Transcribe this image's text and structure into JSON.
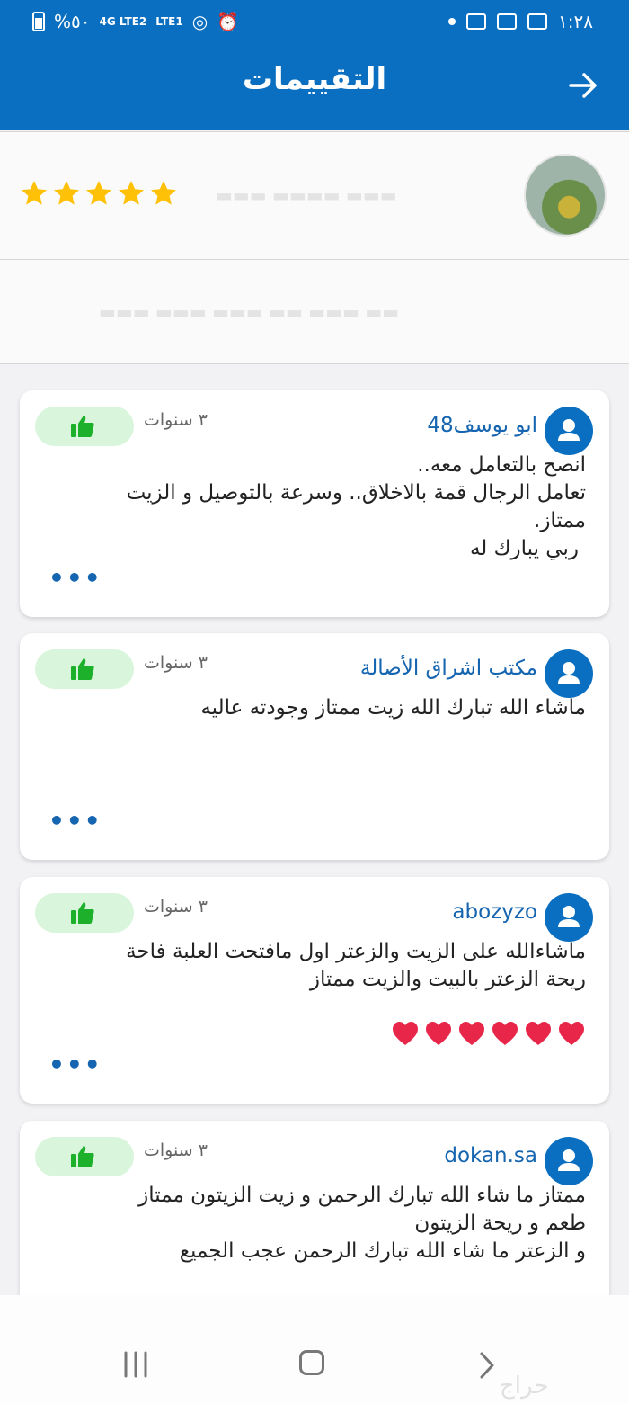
{
  "status_bar": {
    "battery_percent": "%٥٠",
    "network_1": "4G LTE2",
    "network_2": "LTE1",
    "time": "١:٢٨"
  },
  "header": {
    "title": "التقييمات",
    "back_icon": "arrow-right-icon"
  },
  "summary": {
    "rating_stars": 5,
    "star_color": "#ffc107"
  },
  "reviews": [
    {
      "author": "ابو يوسف48",
      "age": "٣ سنوات",
      "lines": [
        "انصح بالتعامل معه..",
        "تعامل الرجال قمة بالاخلاق.. وسرعة بالتوصيل و الزيت",
        "ممتاز.",
        "ربي يبارك له"
      ],
      "more": "•••"
    },
    {
      "author": "مكتب اشراق الأصالة",
      "age": "٣ سنوات",
      "lines": [
        "ماشاء الله تبارك الله زيت ممتاز وجودته عاليه"
      ],
      "more": "•••"
    },
    {
      "author": "abozyzo",
      "age": "٣ سنوات",
      "lines": [
        "ماشاءالله على الزيت والزعتر اول مافتحت العلبة فاحة",
        "ريحة الزعتر بالبيت والزيت ممتاز"
      ],
      "hearts": 6,
      "more": "•••"
    },
    {
      "author": "dokan.sa",
      "age": "٣ سنوات",
      "lines": [
        "ممتاز ما شاء الله تبارك الرحمن و زيت الزيتون ممتاز",
        "طعم و ريحة الزيتون",
        "و الزعتر ما شاء الله تبارك الرحمن عجب الجميع"
      ]
    }
  ],
  "colors": {
    "primary": "#0a6fc0",
    "link": "#1565b0",
    "like_bg": "#d9f5dc",
    "like_icon": "#1db02a",
    "heart": "#e8264a"
  },
  "watermark": "حراج"
}
